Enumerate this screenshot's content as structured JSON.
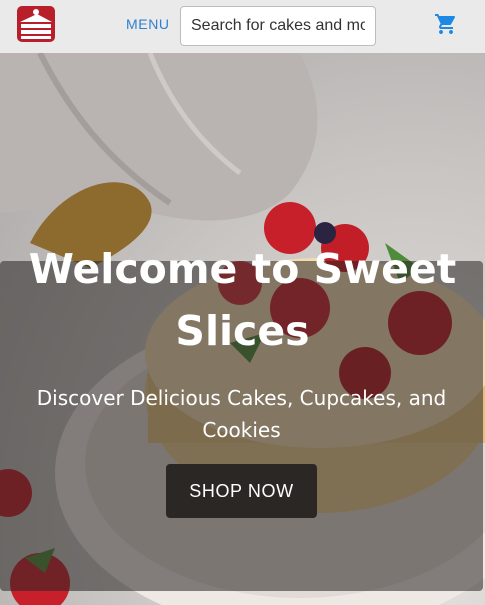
{
  "header": {
    "logo_icon": "cake-slice-icon",
    "menu_label": "MENU",
    "search_placeholder": "Search for cakes and more",
    "cart_icon": "shopping-cart-icon"
  },
  "hero": {
    "title": "Welcome to Sweet Slices",
    "subtitle": "Discover Delicious Cakes, Cupcakes, and Cookies",
    "cta_label": "SHOP NOW"
  },
  "colors": {
    "header_bg": "#eaeaea",
    "menu_text": "#2f7fd0",
    "cart_icon": "#1e88e5",
    "logo_red": "#b81f2b",
    "button_bg": "#2b2725"
  }
}
